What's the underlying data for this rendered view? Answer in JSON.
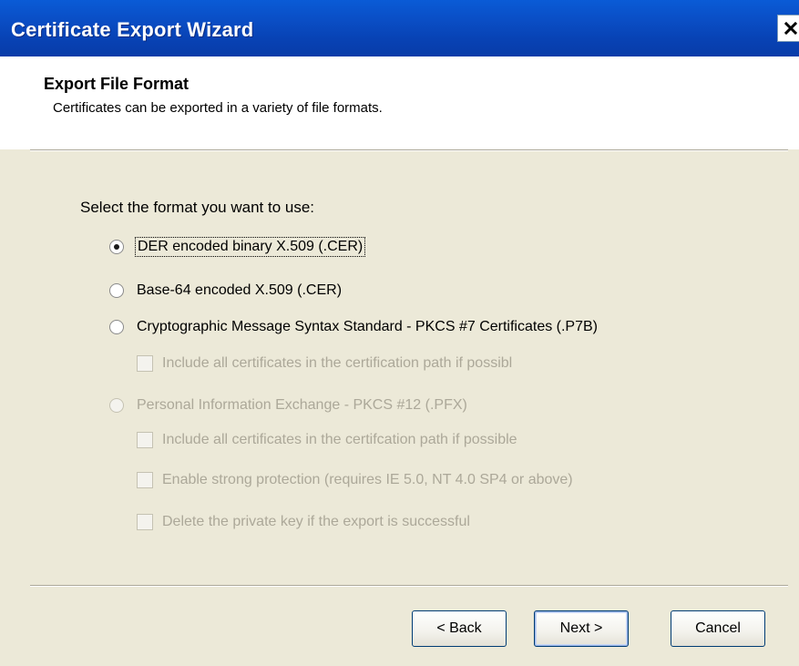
{
  "window": {
    "title": "Certificate Export Wizard",
    "close_glyph": "×"
  },
  "header": {
    "title": "Export File Format",
    "subtitle": "Certificates can be exported in a variety of file formats."
  },
  "form": {
    "prompt": "Select the format you want to use:",
    "options": [
      {
        "label": "DER encoded binary X.509 (.CER)",
        "selected": true,
        "enabled": true
      },
      {
        "label": "Base-64 encoded X.509 (.CER)",
        "selected": false,
        "enabled": true
      },
      {
        "label": "Cryptographic Message Syntax Standard - PKCS #7 Certificates (.P7B)",
        "selected": false,
        "enabled": true
      },
      {
        "label": "Personal Information Exchange - PKCS #12 (.PFX)",
        "selected": false,
        "enabled": false
      }
    ],
    "p7b_checkboxes": [
      {
        "label": "Include all certificates in the certification path if possibl",
        "checked": false,
        "enabled": false
      }
    ],
    "pfx_checkboxes": [
      {
        "label": "Include all certificates in the certifcation path if possible",
        "checked": false,
        "enabled": false
      },
      {
        "label": "Enable strong protection (requires IE 5.0, NT 4.0 SP4 or above)",
        "checked": false,
        "enabled": false
      },
      {
        "label": "Delete the private key if the export is successful",
        "checked": false,
        "enabled": false
      }
    ]
  },
  "buttons": {
    "back": "< Back",
    "next": "Next >",
    "cancel": "Cancel"
  },
  "colors": {
    "titlebar": "#0a50c8",
    "dialog_bg": "#ece9d8",
    "disabled_text": "#aca899"
  }
}
